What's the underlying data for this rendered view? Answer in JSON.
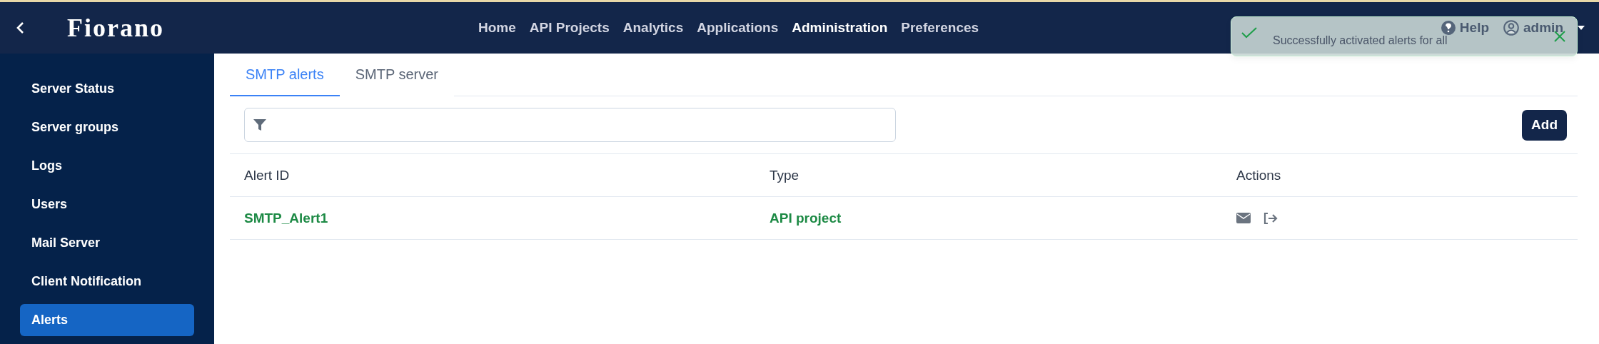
{
  "header": {
    "logo": "Fiorano",
    "nav": [
      {
        "label": "Home",
        "selected": false
      },
      {
        "label": "API Projects",
        "selected": false
      },
      {
        "label": "Analytics",
        "selected": false
      },
      {
        "label": "Applications",
        "selected": false
      },
      {
        "label": "Administration",
        "selected": true
      },
      {
        "label": "Preferences",
        "selected": false
      }
    ],
    "help": "Help",
    "user": "admin"
  },
  "toast": {
    "message": "Successfully activated alerts for all"
  },
  "sidebar": {
    "items": [
      {
        "label": "Server Status",
        "selected": false
      },
      {
        "label": "Server groups",
        "selected": false
      },
      {
        "label": "Logs",
        "selected": false
      },
      {
        "label": "Users",
        "selected": false
      },
      {
        "label": "Mail Server",
        "selected": false
      },
      {
        "label": "Client Notification",
        "selected": false
      },
      {
        "label": "Alerts",
        "selected": true
      }
    ]
  },
  "tabs": [
    {
      "label": "SMTP alerts",
      "selected": true
    },
    {
      "label": "SMTP server",
      "selected": false
    }
  ],
  "add_button": "Add",
  "table": {
    "columns": [
      "Alert ID",
      "Type",
      "Actions"
    ],
    "rows": [
      {
        "alert_id": "SMTP_Alert1",
        "type": "API project"
      }
    ]
  }
}
